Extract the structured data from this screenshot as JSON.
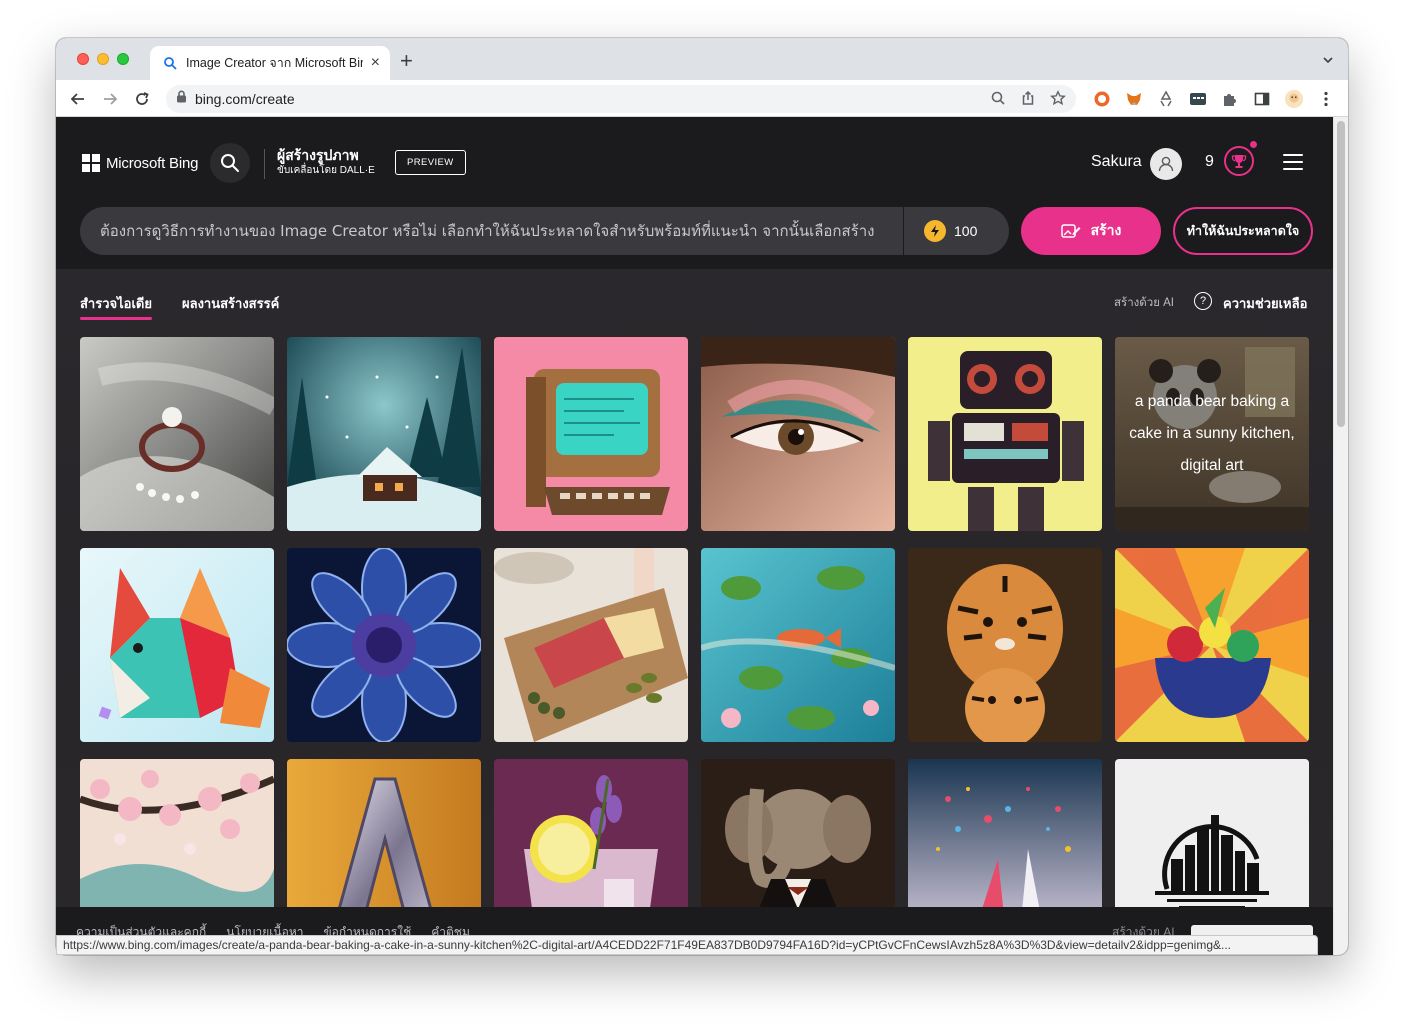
{
  "browser": {
    "tab_title": "Image Creator จาก Microsoft Bing",
    "new_tab_symbol": "+",
    "tab_close_symbol": "×",
    "url": "bing.com/create",
    "status_url": "https://www.bing.com/images/create/a-panda-bear-baking-a-cake-in-a-sunny-kitchen%2C-digital-art/A4CEDD22F71F49EA837DB0D9794FA16D?id=yCPtGvCFnCewsIAvzh5z8A%3D%3D&view=detailv2&idpp=genimg&..."
  },
  "header": {
    "brand": "Microsoft Bing",
    "product_title": "ผู้สร้างรูปภาพ",
    "product_subtitle": "ขับเคลื่อนโดย DALL·E",
    "preview_badge": "PREVIEW",
    "username": "Sakura",
    "rewards_count": "9"
  },
  "prompt": {
    "placeholder": "ต้องการดูวิธีการทำงานของ Image Creator หรือไม่ เลือกทำให้ฉันประหลาดใจสำหรับพร้อมท์ที่แนะนำ จากนั้นเลือกสร้าง",
    "boosts": "100",
    "create_label": "สร้าง",
    "surprise_label": "ทำให้ฉันประหลาดใจ"
  },
  "subnav": {
    "tabs": [
      {
        "label": "สำรวจไอเดีย",
        "active": true
      },
      {
        "label": "ผลงานสร้างสรรค์",
        "active": false
      }
    ],
    "ai_credit": "สร้างด้วย AI",
    "help_label": "ความช่วยเหลือ",
    "help_symbol": "?"
  },
  "gallery": {
    "images": [
      {
        "name": "pearl-ring"
      },
      {
        "name": "snowy-cabin"
      },
      {
        "name": "retro-computer"
      },
      {
        "name": "eye-makeup"
      },
      {
        "name": "retro-robot"
      },
      {
        "name": "panda-baking",
        "caption": "a panda bear baking a cake in a sunny kitchen, digital art"
      },
      {
        "name": "paper-fox"
      },
      {
        "name": "blue-dahlia"
      },
      {
        "name": "charcuterie-board"
      },
      {
        "name": "koi-pond"
      },
      {
        "name": "tiger-dolls"
      },
      {
        "name": "fruit-bowl"
      },
      {
        "name": "cherry-blossom"
      },
      {
        "name": "letter-a"
      },
      {
        "name": "lavender-cocktail"
      },
      {
        "name": "elephant-tuxedo"
      },
      {
        "name": "paint-splash"
      },
      {
        "name": "city-logo"
      }
    ]
  },
  "footer": {
    "links": [
      "ความเป็นส่วนตัวและคุกกี้",
      "นโยบายเนื้อหา",
      "ข้อกำหนดการใช้",
      "คำติชม"
    ],
    "ai_credit": "สร้างด้วย AI"
  },
  "colors": {
    "accent": "#e8318a",
    "page_bg": "#1b1a1c",
    "boost": "#f5b730"
  }
}
